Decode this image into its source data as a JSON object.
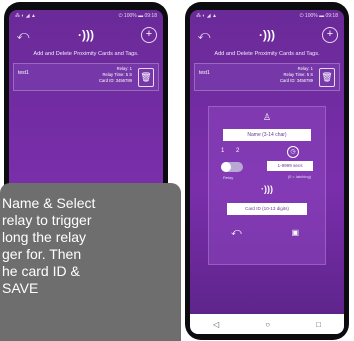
{
  "left_screen": {
    "status": {
      "left": "⁂ ◐ ◢ ▲",
      "right": "⏻ 100% ▬ 09:18"
    },
    "subtitle": "Add and Delete Proximity Cards and Tags.",
    "card": {
      "name": "test1",
      "relay": "Relay: 1",
      "time": "Relay Time: 5 S",
      "card_id": "Card ID: 3456789"
    }
  },
  "right_screen": {
    "status": {
      "left": "⁂ ◐ ◢ ▲",
      "right": "⏻ 100% ▬ 09:18"
    },
    "subtitle": "Add and Delete Proximity Cards and Tags.",
    "card": {
      "name": "test1",
      "relay": "Relay: 1",
      "time": "Relay Time: 5 S",
      "card_id": "Card ID: 3456789"
    },
    "form": {
      "name_placeholder": "Name (3-14 char)",
      "relay_1": "1",
      "relay_2": "2",
      "relay_label": "Relay",
      "secs_placeholder": "1-9999 secs",
      "latch_label": "(0 = latching)",
      "cardid_placeholder": "Card ID (10-13 digits)"
    },
    "nav": {
      "back": "◁",
      "home": "○",
      "recent": "□"
    }
  },
  "overlay": {
    "text": "Name & Select\nrelay to trigger\nlong the relay\nger for. Then\nhe card ID &\n SAVE"
  },
  "icons": {
    "back": "back-arrow-icon",
    "nfc": "nfc-icon",
    "add": "add-icon",
    "trash": "trash-icon",
    "user": "user-icon",
    "clock": "clock-icon",
    "save": "save-icon"
  },
  "colors": {
    "accent_purple": "#7a2eab",
    "overlay_gray": "#6e6e6e",
    "toggle_on": "#b9a8d6"
  }
}
